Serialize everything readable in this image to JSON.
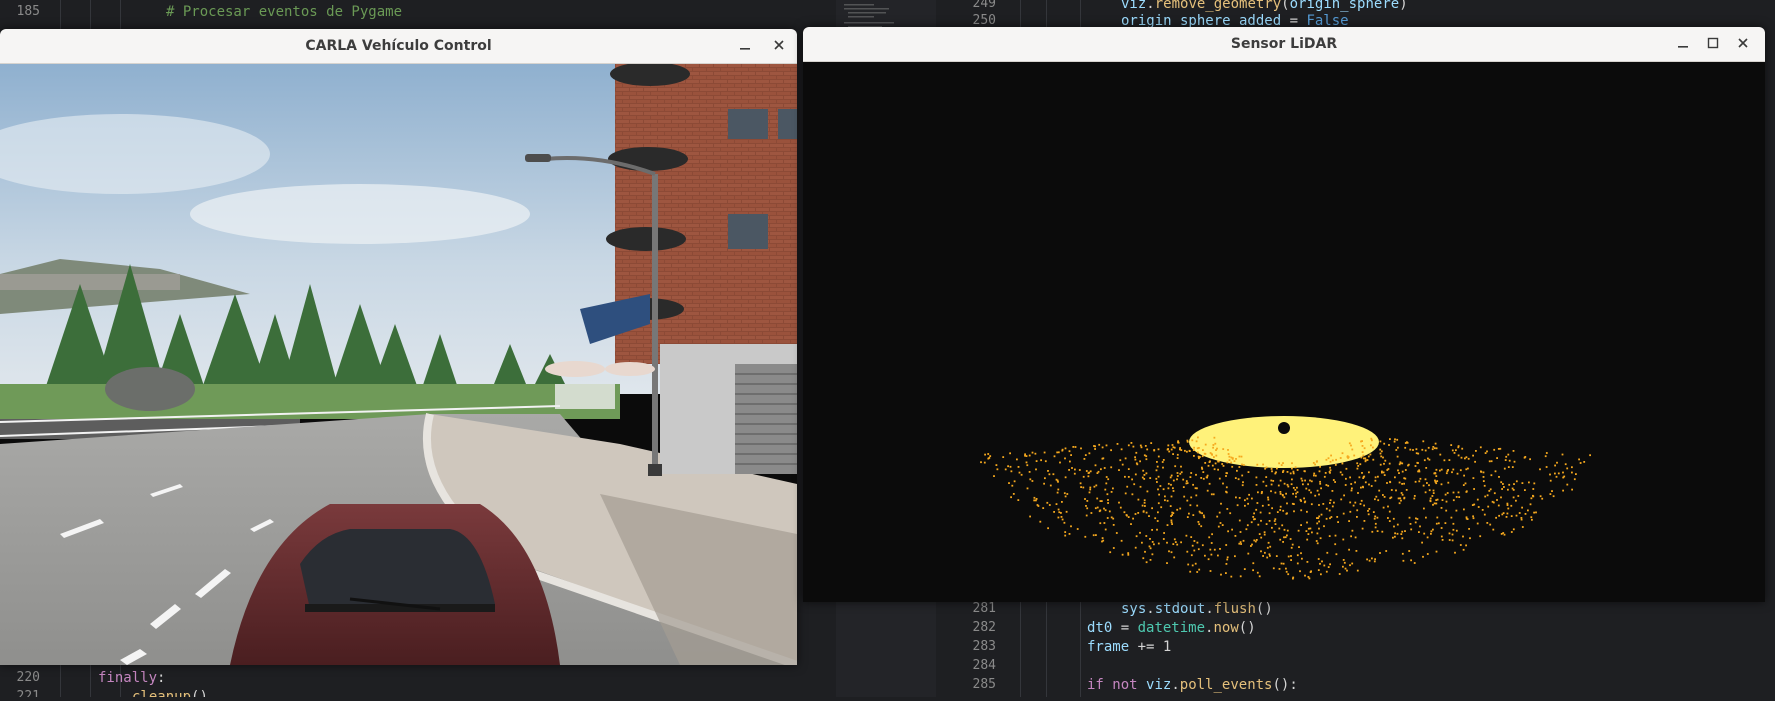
{
  "left_editor": {
    "lines": [
      {
        "num": "185",
        "tokens": [
          {
            "t": "# Procesar eventos de Pygame",
            "c": "cm"
          }
        ]
      },
      {
        "num": "220",
        "tokens": [
          {
            "t": "finally",
            "c": "kw"
          },
          {
            "t": ":",
            "c": "plain"
          }
        ]
      },
      {
        "num": "221",
        "tokens": [
          {
            "t": "cleanup",
            "c": "fn"
          },
          {
            "t": "()",
            "c": "plain"
          }
        ]
      }
    ]
  },
  "right_editor": {
    "top_lines": [
      {
        "num": "249",
        "tokens": [
          {
            "t": "viz",
            "c": "id"
          },
          {
            "t": ".",
            "c": "plain"
          },
          {
            "t": "remove_geometry",
            "c": "fn"
          },
          {
            "t": "(",
            "c": "plain"
          },
          {
            "t": "origin_sphere",
            "c": "id"
          },
          {
            "t": ")",
            "c": "plain"
          }
        ]
      },
      {
        "num": "250",
        "tokens": [
          {
            "t": "origin_sphere_added",
            "c": "id"
          },
          {
            "t": " = ",
            "c": "plain"
          },
          {
            "t": "False",
            "c": "bool"
          }
        ]
      }
    ],
    "bottom_lines": [
      {
        "num": "281",
        "tokens": [
          {
            "t": "sys",
            "c": "id"
          },
          {
            "t": ".",
            "c": "plain"
          },
          {
            "t": "stdout",
            "c": "id"
          },
          {
            "t": ".",
            "c": "plain"
          },
          {
            "t": "flush",
            "c": "fn"
          },
          {
            "t": "()",
            "c": "plain"
          }
        ]
      },
      {
        "num": "282",
        "tokens": [
          {
            "t": "dt0",
            "c": "id"
          },
          {
            "t": " = ",
            "c": "plain"
          },
          {
            "t": "datetime",
            "c": "cls"
          },
          {
            "t": ".",
            "c": "plain"
          },
          {
            "t": "now",
            "c": "fn"
          },
          {
            "t": "()",
            "c": "plain"
          }
        ]
      },
      {
        "num": "283",
        "tokens": [
          {
            "t": "frame",
            "c": "id"
          },
          {
            "t": " += ",
            "c": "plain"
          },
          {
            "t": "1",
            "c": "plain"
          }
        ]
      },
      {
        "num": "284",
        "tokens": []
      },
      {
        "num": "285",
        "tokens": [
          {
            "t": "if",
            "c": "kw"
          },
          {
            "t": " ",
            "c": "plain"
          },
          {
            "t": "not",
            "c": "kw"
          },
          {
            "t": " ",
            "c": "plain"
          },
          {
            "t": "viz",
            "c": "id"
          },
          {
            "t": ".",
            "c": "plain"
          },
          {
            "t": "poll_events",
            "c": "fn"
          },
          {
            "t": "():",
            "c": "plain"
          }
        ]
      }
    ]
  },
  "carla_window": {
    "title": "CARLA Vehículo Control",
    "minimize_icon": "minimize-icon",
    "close_icon": "close-icon"
  },
  "lidar_window": {
    "title": "Sensor LiDAR",
    "minimize_icon": "minimize-icon",
    "maximize_icon": "maximize-icon",
    "close_icon": "close-icon",
    "point_color": "#f5a81e",
    "center_color": "#fff27a",
    "background_color": "#0b0b0b"
  },
  "colors": {
    "editor_bg": "#1e1f22",
    "titlebar_bg": "#f6f5f4"
  }
}
